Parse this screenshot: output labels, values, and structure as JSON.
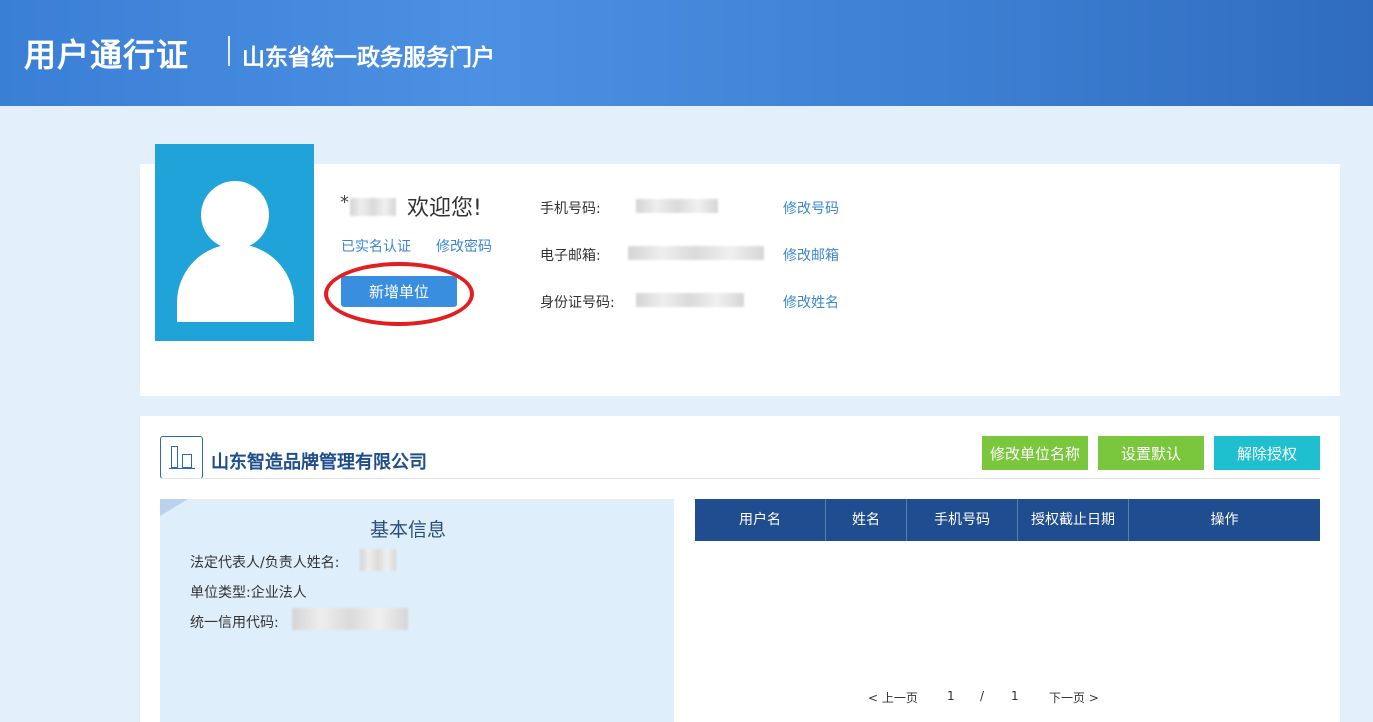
{
  "header": {
    "brand_main": "用户通行证",
    "brand_sub": "山东省统一政务服务门户"
  },
  "profile": {
    "username_prefix": "*",
    "welcome": "欢迎您!",
    "verified_link": "已实名认证",
    "change_password_link": "修改密码",
    "add_org_button": "新增单位",
    "phone_label": "手机号码:",
    "email_label": "电子邮箱:",
    "id_label": "身份证号码:",
    "change_phone_link": "修改号码",
    "change_email_link": "修改邮箱",
    "change_name_link": "修改姓名"
  },
  "organization": {
    "name": "山东智造品牌管理有限公司",
    "rename_button": "修改单位名称",
    "set_default_button": "设置默认",
    "revoke_button": "解除授权",
    "basic_info": {
      "title": "基本信息",
      "legal_rep_label": "法定代表人/负责人姓名:",
      "org_type_label": "单位类型:",
      "org_type_value": "企业法人",
      "credit_code_label": "统一信用代码:"
    },
    "table": {
      "columns": [
        "用户名",
        "姓名",
        "手机号码",
        "授权截止日期",
        "操作"
      ]
    },
    "pager": {
      "prev": "< 上一页",
      "current": "1",
      "sep": "/",
      "total": "1",
      "next": "下一页 >"
    }
  },
  "colors": {
    "header": "#3a7fd6",
    "avatar_bg": "#1fa3d9",
    "primary_button": "#3a8ee0",
    "green_button": "#7ac63d",
    "cyan_button": "#1ec0d0",
    "table_header": "#1f4d8f",
    "highlight_ring": "#e21e1e"
  }
}
